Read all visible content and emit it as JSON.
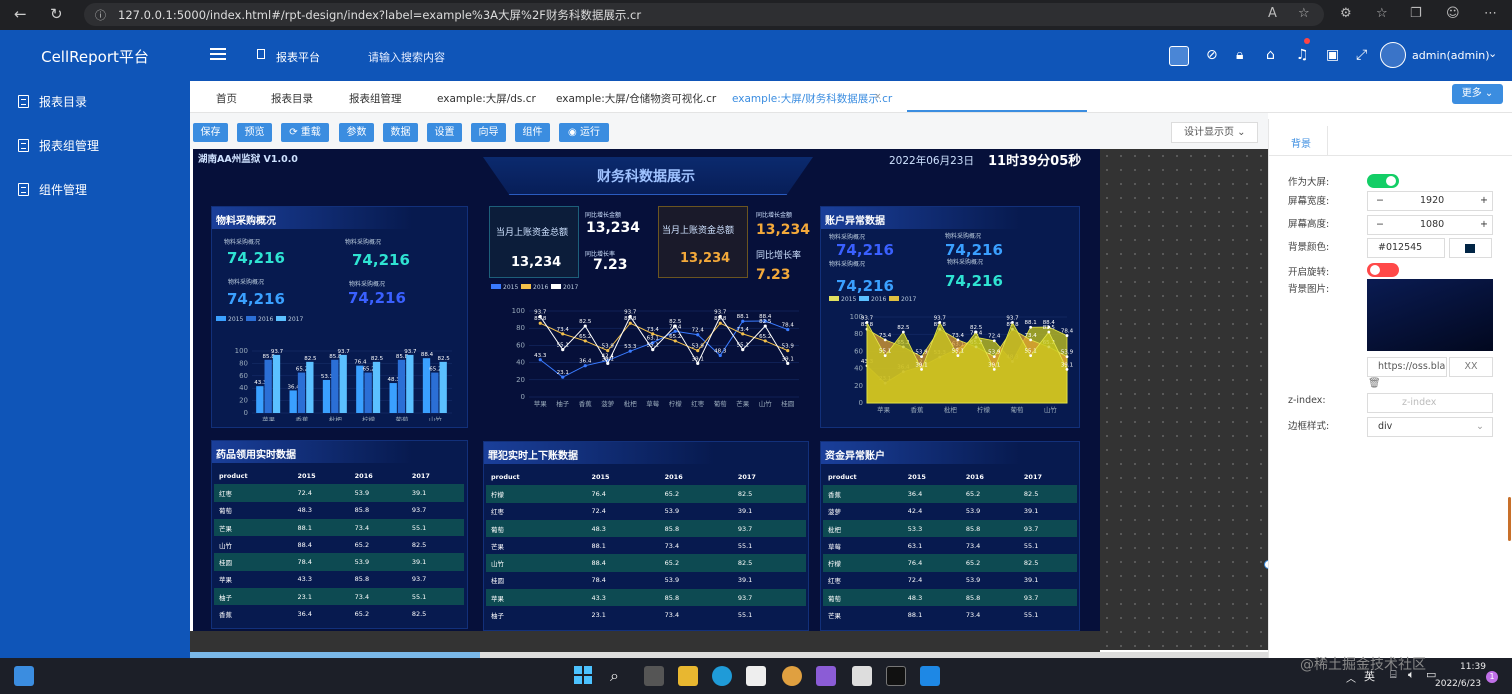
{
  "browser": {
    "url": "127.0.0.1:5000/index.html#/rpt-design/index?label=example%3A大屏%2F财务科数据展示.cr"
  },
  "sidebar": {
    "brand": "CellReport平台",
    "items": [
      {
        "label": "报表目录"
      },
      {
        "label": "报表组管理"
      },
      {
        "label": "组件管理"
      }
    ]
  },
  "header": {
    "menu_label": "报表平台",
    "search_placeholder": "请输入搜索内容",
    "user": "admin(admin)"
  },
  "tabs": [
    {
      "label": "首页"
    },
    {
      "label": "报表目录"
    },
    {
      "label": "报表组管理"
    },
    {
      "label": "example:大屏/ds.cr"
    },
    {
      "label": "example:大屏/仓储物资可视化.cr"
    },
    {
      "label": "example:大屏/财务科数据展示.cr"
    }
  ],
  "more_label": "更多",
  "toolbar": {
    "buttons": [
      "保存",
      "预览",
      "重载",
      "参数",
      "数据",
      "设置",
      "向导",
      "组件",
      "运行"
    ],
    "design_select": "设计显示页"
  },
  "dashboard": {
    "version": "湖南AA州监狱 V1.0.0",
    "title": "财务科数据展示",
    "date": "2022年06月23日",
    "time": "11时39分05秒",
    "panel1": {
      "title": "物料采购概况",
      "kpis": [
        {
          "label": "物料采购概况",
          "value": "74,216"
        },
        {
          "label": "物料采购概况",
          "value": "74,216"
        },
        {
          "label": "物料采购概况",
          "value": "74,216"
        },
        {
          "label": "物料采购概况",
          "value": "74,216"
        }
      ],
      "legend": [
        "2015",
        "2016",
        "2017"
      ]
    },
    "center": {
      "card1": {
        "label": "当月上账资金总额",
        "value": "13,234",
        "yoy_label": "同比增长金额",
        "yoy_value": "13,234",
        "rate_label": "同比增长率",
        "rate_value": "7.23"
      },
      "card2": {
        "label": "当月上账资金总额",
        "value": "13,234",
        "yoy_label": "同比增长金额",
        "yoy_value": "13,234",
        "rate_label": "同比增长率",
        "rate_value": "7.23"
      },
      "legend": [
        "2015",
        "2016",
        "2017"
      ]
    },
    "panel3": {
      "title": "账户异常数据",
      "kpis": [
        {
          "label": "物料采购概况",
          "value": "74,216"
        },
        {
          "label": "物料采购概况",
          "value": "74,216"
        },
        {
          "label": "物料采购概况",
          "value": "74,216"
        },
        {
          "label": "物料采购概况",
          "value": "74,216"
        }
      ],
      "legend": [
        "2015",
        "2016",
        "2017"
      ]
    },
    "table1": {
      "title": "药品领用实时数据",
      "headers": [
        "product",
        "2015",
        "2016",
        "2017"
      ],
      "rows": [
        [
          "红枣",
          "72.4",
          "53.9",
          "39.1"
        ],
        [
          "葡萄",
          "48.3",
          "85.8",
          "93.7"
        ],
        [
          "芒果",
          "88.1",
          "73.4",
          "55.1"
        ],
        [
          "山竹",
          "88.4",
          "65.2",
          "82.5"
        ],
        [
          "桂圆",
          "78.4",
          "53.9",
          "39.1"
        ],
        [
          "苹果",
          "43.3",
          "85.8",
          "93.7"
        ],
        [
          "柚子",
          "23.1",
          "73.4",
          "55.1"
        ],
        [
          "香蕉",
          "36.4",
          "65.2",
          "82.5"
        ]
      ]
    },
    "table2": {
      "title": "罪犯实时上下账数据",
      "headers": [
        "product",
        "2015",
        "2016",
        "2017"
      ],
      "rows": [
        [
          "柠檬",
          "76.4",
          "65.2",
          "82.5"
        ],
        [
          "红枣",
          "72.4",
          "53.9",
          "39.1"
        ],
        [
          "葡萄",
          "48.3",
          "85.8",
          "93.7"
        ],
        [
          "芒果",
          "88.1",
          "73.4",
          "55.1"
        ],
        [
          "山竹",
          "88.4",
          "65.2",
          "82.5"
        ],
        [
          "桂圆",
          "78.4",
          "53.9",
          "39.1"
        ],
        [
          "苹果",
          "43.3",
          "85.8",
          "93.7"
        ],
        [
          "柚子",
          "23.1",
          "73.4",
          "55.1"
        ]
      ]
    },
    "table3": {
      "title": "资金异常账户",
      "headers": [
        "product",
        "2015",
        "2016",
        "2017"
      ],
      "rows": [
        [
          "香蕉",
          "36.4",
          "65.2",
          "82.5"
        ],
        [
          "菠萝",
          "42.4",
          "53.9",
          "39.1"
        ],
        [
          "枇杷",
          "53.3",
          "85.8",
          "93.7"
        ],
        [
          "草莓",
          "63.1",
          "73.4",
          "55.1"
        ],
        [
          "柠檬",
          "76.4",
          "65.2",
          "82.5"
        ],
        [
          "红枣",
          "72.4",
          "53.9",
          "39.1"
        ],
        [
          "葡萄",
          "48.3",
          "85.8",
          "93.7"
        ],
        [
          "芒果",
          "88.1",
          "73.4",
          "55.1"
        ]
      ]
    }
  },
  "chart_data": [
    {
      "type": "bar",
      "categories": [
        "苹果",
        "香蕉",
        "枇杷",
        "柠檬",
        "葡萄",
        "山竹"
      ],
      "ylim": [
        0,
        100
      ],
      "series": [
        {
          "name": "2015",
          "values": [
            43.3,
            36.4,
            53.3,
            76.4,
            48.3,
            88.4
          ]
        },
        {
          "name": "2016",
          "values": [
            85.8,
            65.2,
            85.8,
            65.2,
            85.8,
            65.2
          ]
        },
        {
          "name": "2017",
          "values": [
            93.7,
            82.5,
            93.7,
            82.5,
            93.7,
            82.5
          ]
        }
      ]
    },
    {
      "type": "line",
      "categories": [
        "苹果",
        "柚子",
        "香蕉",
        "菠萝",
        "枇杷",
        "草莓",
        "柠檬",
        "红枣",
        "葡萄",
        "芒果",
        "山竹",
        "桂圆"
      ],
      "ylim": [
        0,
        100
      ],
      "series": [
        {
          "name": "2015",
          "values": [
            43.3,
            23.1,
            36.4,
            42.4,
            53.3,
            63.1,
            76.4,
            72.4,
            48.3,
            88.1,
            88.4,
            78.4
          ]
        },
        {
          "name": "2016",
          "values": [
            85.8,
            73.4,
            65.2,
            53.9,
            85.8,
            73.4,
            65.2,
            53.9,
            85.8,
            73.4,
            65.2,
            53.9
          ]
        },
        {
          "name": "2017",
          "values": [
            93.7,
            55.1,
            82.5,
            39.1,
            93.7,
            55.1,
            82.5,
            39.1,
            93.7,
            55.1,
            82.5,
            39.1
          ]
        }
      ]
    },
    {
      "type": "area",
      "categories": [
        "苹果",
        "香蕉",
        "枇杷",
        "柠檬",
        "葡萄",
        "山竹"
      ],
      "ylim": [
        0,
        100
      ],
      "series": [
        {
          "name": "2015",
          "values": [
            43.3,
            23.1,
            36.4,
            42.4,
            53.3,
            63.1,
            76.4,
            72.4,
            48.3,
            88.1,
            88.4,
            78.4
          ]
        },
        {
          "name": "2016",
          "values": [
            85.8,
            73.4,
            65.2,
            53.9,
            85.8,
            73.4,
            65.2,
            53.9,
            85.8,
            73.4,
            65.2,
            53.9
          ]
        },
        {
          "name": "2017",
          "values": [
            93.7,
            55.1,
            82.5,
            39.1,
            93.7,
            55.1,
            82.5,
            39.1,
            93.7,
            55.1,
            82.5,
            39.1
          ]
        }
      ]
    }
  ],
  "props": {
    "tab_label": "背景",
    "labels": [
      "作为大屏:",
      "屏幕宽度:",
      "屏幕高度:",
      "背景颜色:",
      "开启旋转:",
      "背景图片:",
      "z-index:",
      "边框样式:"
    ],
    "width": "1920",
    "height": "1080",
    "bgcolor": "#012545",
    "image_url": "https://oss.bla",
    "clear": "XX",
    "zindex_placeholder": "z-index",
    "border": "div",
    "big_screen": true,
    "rotate": false
  },
  "taskbar": {
    "time": "11:39",
    "date": "2022/6/23",
    "lang": "英",
    "notify": "1",
    "watermark": "@稀土掘金技术社区"
  }
}
